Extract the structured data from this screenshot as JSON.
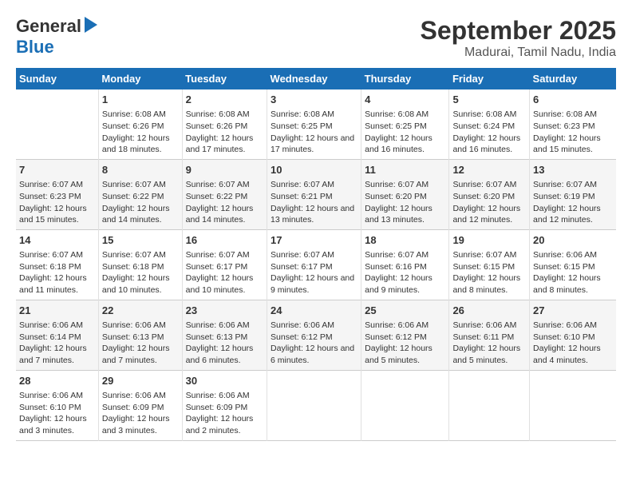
{
  "logo": {
    "general": "General",
    "blue": "Blue"
  },
  "title": "September 2025",
  "location": "Madurai, Tamil Nadu, India",
  "days_of_week": [
    "Sunday",
    "Monday",
    "Tuesday",
    "Wednesday",
    "Thursday",
    "Friday",
    "Saturday"
  ],
  "weeks": [
    [
      {
        "date": "",
        "sunrise": "",
        "sunset": "",
        "daylight": ""
      },
      {
        "date": "1",
        "sunrise": "Sunrise: 6:08 AM",
        "sunset": "Sunset: 6:26 PM",
        "daylight": "Daylight: 12 hours and 18 minutes."
      },
      {
        "date": "2",
        "sunrise": "Sunrise: 6:08 AM",
        "sunset": "Sunset: 6:26 PM",
        "daylight": "Daylight: 12 hours and 17 minutes."
      },
      {
        "date": "3",
        "sunrise": "Sunrise: 6:08 AM",
        "sunset": "Sunset: 6:25 PM",
        "daylight": "Daylight: 12 hours and 17 minutes."
      },
      {
        "date": "4",
        "sunrise": "Sunrise: 6:08 AM",
        "sunset": "Sunset: 6:25 PM",
        "daylight": "Daylight: 12 hours and 16 minutes."
      },
      {
        "date": "5",
        "sunrise": "Sunrise: 6:08 AM",
        "sunset": "Sunset: 6:24 PM",
        "daylight": "Daylight: 12 hours and 16 minutes."
      },
      {
        "date": "6",
        "sunrise": "Sunrise: 6:08 AM",
        "sunset": "Sunset: 6:23 PM",
        "daylight": "Daylight: 12 hours and 15 minutes."
      }
    ],
    [
      {
        "date": "7",
        "sunrise": "Sunrise: 6:07 AM",
        "sunset": "Sunset: 6:23 PM",
        "daylight": "Daylight: 12 hours and 15 minutes."
      },
      {
        "date": "8",
        "sunrise": "Sunrise: 6:07 AM",
        "sunset": "Sunset: 6:22 PM",
        "daylight": "Daylight: 12 hours and 14 minutes."
      },
      {
        "date": "9",
        "sunrise": "Sunrise: 6:07 AM",
        "sunset": "Sunset: 6:22 PM",
        "daylight": "Daylight: 12 hours and 14 minutes."
      },
      {
        "date": "10",
        "sunrise": "Sunrise: 6:07 AM",
        "sunset": "Sunset: 6:21 PM",
        "daylight": "Daylight: 12 hours and 13 minutes."
      },
      {
        "date": "11",
        "sunrise": "Sunrise: 6:07 AM",
        "sunset": "Sunset: 6:20 PM",
        "daylight": "Daylight: 12 hours and 13 minutes."
      },
      {
        "date": "12",
        "sunrise": "Sunrise: 6:07 AM",
        "sunset": "Sunset: 6:20 PM",
        "daylight": "Daylight: 12 hours and 12 minutes."
      },
      {
        "date": "13",
        "sunrise": "Sunrise: 6:07 AM",
        "sunset": "Sunset: 6:19 PM",
        "daylight": "Daylight: 12 hours and 12 minutes."
      }
    ],
    [
      {
        "date": "14",
        "sunrise": "Sunrise: 6:07 AM",
        "sunset": "Sunset: 6:18 PM",
        "daylight": "Daylight: 12 hours and 11 minutes."
      },
      {
        "date": "15",
        "sunrise": "Sunrise: 6:07 AM",
        "sunset": "Sunset: 6:18 PM",
        "daylight": "Daylight: 12 hours and 10 minutes."
      },
      {
        "date": "16",
        "sunrise": "Sunrise: 6:07 AM",
        "sunset": "Sunset: 6:17 PM",
        "daylight": "Daylight: 12 hours and 10 minutes."
      },
      {
        "date": "17",
        "sunrise": "Sunrise: 6:07 AM",
        "sunset": "Sunset: 6:17 PM",
        "daylight": "Daylight: 12 hours and 9 minutes."
      },
      {
        "date": "18",
        "sunrise": "Sunrise: 6:07 AM",
        "sunset": "Sunset: 6:16 PM",
        "daylight": "Daylight: 12 hours and 9 minutes."
      },
      {
        "date": "19",
        "sunrise": "Sunrise: 6:07 AM",
        "sunset": "Sunset: 6:15 PM",
        "daylight": "Daylight: 12 hours and 8 minutes."
      },
      {
        "date": "20",
        "sunrise": "Sunrise: 6:06 AM",
        "sunset": "Sunset: 6:15 PM",
        "daylight": "Daylight: 12 hours and 8 minutes."
      }
    ],
    [
      {
        "date": "21",
        "sunrise": "Sunrise: 6:06 AM",
        "sunset": "Sunset: 6:14 PM",
        "daylight": "Daylight: 12 hours and 7 minutes."
      },
      {
        "date": "22",
        "sunrise": "Sunrise: 6:06 AM",
        "sunset": "Sunset: 6:13 PM",
        "daylight": "Daylight: 12 hours and 7 minutes."
      },
      {
        "date": "23",
        "sunrise": "Sunrise: 6:06 AM",
        "sunset": "Sunset: 6:13 PM",
        "daylight": "Daylight: 12 hours and 6 minutes."
      },
      {
        "date": "24",
        "sunrise": "Sunrise: 6:06 AM",
        "sunset": "Sunset: 6:12 PM",
        "daylight": "Daylight: 12 hours and 6 minutes."
      },
      {
        "date": "25",
        "sunrise": "Sunrise: 6:06 AM",
        "sunset": "Sunset: 6:12 PM",
        "daylight": "Daylight: 12 hours and 5 minutes."
      },
      {
        "date": "26",
        "sunrise": "Sunrise: 6:06 AM",
        "sunset": "Sunset: 6:11 PM",
        "daylight": "Daylight: 12 hours and 5 minutes."
      },
      {
        "date": "27",
        "sunrise": "Sunrise: 6:06 AM",
        "sunset": "Sunset: 6:10 PM",
        "daylight": "Daylight: 12 hours and 4 minutes."
      }
    ],
    [
      {
        "date": "28",
        "sunrise": "Sunrise: 6:06 AM",
        "sunset": "Sunset: 6:10 PM",
        "daylight": "Daylight: 12 hours and 3 minutes."
      },
      {
        "date": "29",
        "sunrise": "Sunrise: 6:06 AM",
        "sunset": "Sunset: 6:09 PM",
        "daylight": "Daylight: 12 hours and 3 minutes."
      },
      {
        "date": "30",
        "sunrise": "Sunrise: 6:06 AM",
        "sunset": "Sunset: 6:09 PM",
        "daylight": "Daylight: 12 hours and 2 minutes."
      },
      {
        "date": "",
        "sunrise": "",
        "sunset": "",
        "daylight": ""
      },
      {
        "date": "",
        "sunrise": "",
        "sunset": "",
        "daylight": ""
      },
      {
        "date": "",
        "sunrise": "",
        "sunset": "",
        "daylight": ""
      },
      {
        "date": "",
        "sunrise": "",
        "sunset": "",
        "daylight": ""
      }
    ]
  ]
}
